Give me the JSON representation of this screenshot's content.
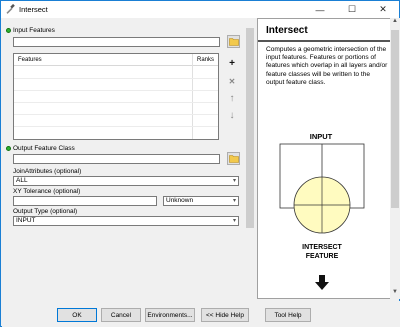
{
  "window": {
    "title": "Intersect",
    "minimize": "—",
    "maximize": "☐",
    "close": "✕"
  },
  "form": {
    "input_features": {
      "label": "Input Features",
      "value": ""
    },
    "table_columns": {
      "features": "Features",
      "ranks": "Ranks"
    },
    "side_buttons": {
      "add": "+",
      "remove": "✕",
      "up": "↑",
      "down": "↓"
    },
    "output_feature_class": {
      "label": "Output Feature Class",
      "value": ""
    },
    "join_attributes": {
      "label": "JoinAttributes (optional)",
      "value": "ALL"
    },
    "xy_tolerance": {
      "label": "XY Tolerance (optional)",
      "value": "",
      "unit": "Unknown"
    },
    "output_type": {
      "label": "Output Type (optional)",
      "value": "INPUT"
    }
  },
  "help": {
    "title": "Intersect",
    "description": "Computes a geometric intersection of the input features. Features or portions of features which overlap in all layers and/or feature classes will be written to the output feature class.",
    "diagram": {
      "input_label": "INPUT",
      "output_label_1": "INTERSECT",
      "output_label_2": "FEATURE"
    }
  },
  "buttons": {
    "ok": "OK",
    "cancel": "Cancel",
    "environments": "Environments...",
    "hide_help": "<< Hide Help",
    "tool_help": "Tool Help"
  },
  "colors": {
    "required_dot": "#2fb52f",
    "circle_fill": "#fffbc0",
    "window_border": "#1a7fd4"
  }
}
